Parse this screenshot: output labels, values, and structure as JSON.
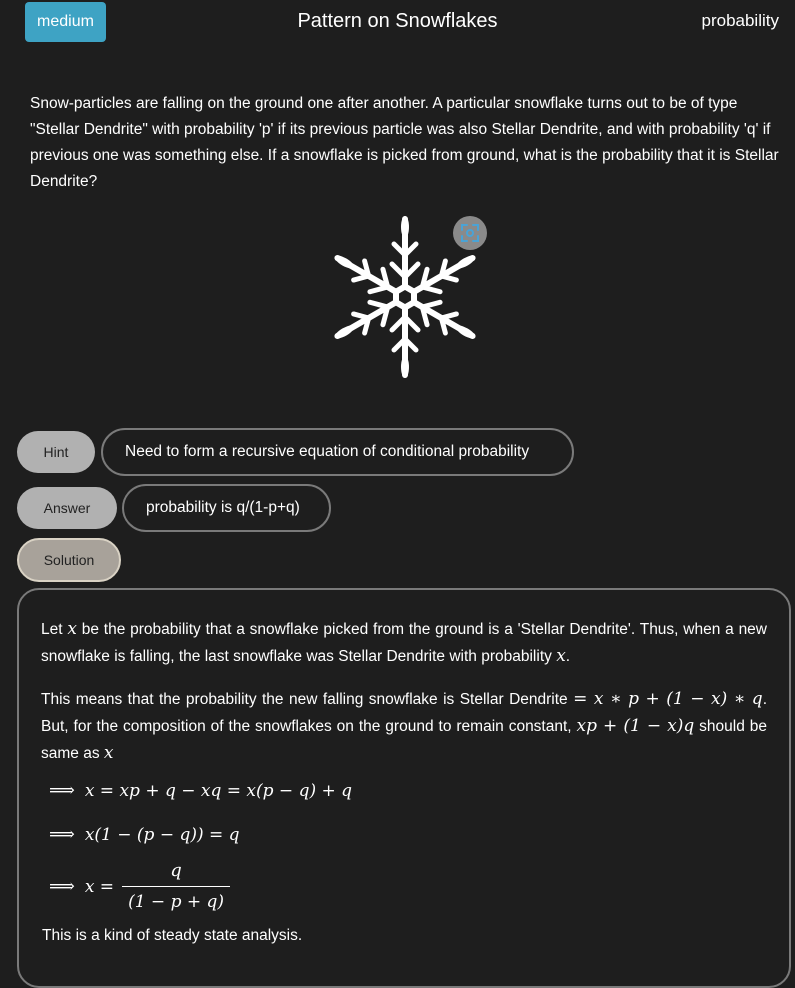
{
  "header": {
    "difficulty": "medium",
    "title": "Pattern on Snowflakes",
    "category": "probability"
  },
  "problem": {
    "text": "Snow-particles are falling on the ground one after another. A particular snowflake turns out to be of type \"Stellar Dendrite\" with probability 'p' if its previous particle was also Stellar Dendrite, and with probability 'q' if previous one was something else. If a snowflake is picked from ground, what is the probability that it is Stellar Dendrite?",
    "image_icon": "snowflake-icon",
    "zoom_icon": "zoom-icon"
  },
  "hint": {
    "button_label": "Hint",
    "text": "Need to form a recursive equation of conditional probability"
  },
  "answer": {
    "button_label": "Answer",
    "text": "probability is q/(1-p+q)"
  },
  "solution": {
    "button_label": "Solution",
    "p1_a": "Let ",
    "p1_var": "x",
    "p1_b": " be the probability that a snowflake picked from the ground is a 'Stellar Dendrite'. Thus, when a new snowflake is falling, the last snowflake was Stellar Dendrite with probability ",
    "p1_var2": "x",
    "p1_c": ".",
    "p2_a": "This means that the probability the new falling snowflake is Stellar Dendrite ",
    "p2_math1": "= x ∗ p + (1 − x) ∗ q",
    "p2_b": ". But, for the composition of the snowflakes on the ground to remain constant, ",
    "p2_math2": "xp + (1 − x)q",
    "p2_c": " should be same as ",
    "p2_var": "x",
    "implies": "⟹",
    "eq1": "x = xp + q − xq = x(p − q) + q",
    "eq2": "x(1 − (p − q)) = q",
    "eq3_lhs": "x =",
    "eq3_num": "q",
    "eq3_den": "(1 − p + q)",
    "closing": "This is a kind of steady state analysis."
  },
  "colors": {
    "background": "#1e1e1e",
    "badge": "#3ea3c4",
    "button": "#b1b1b1",
    "border": "#7a7a7a"
  }
}
